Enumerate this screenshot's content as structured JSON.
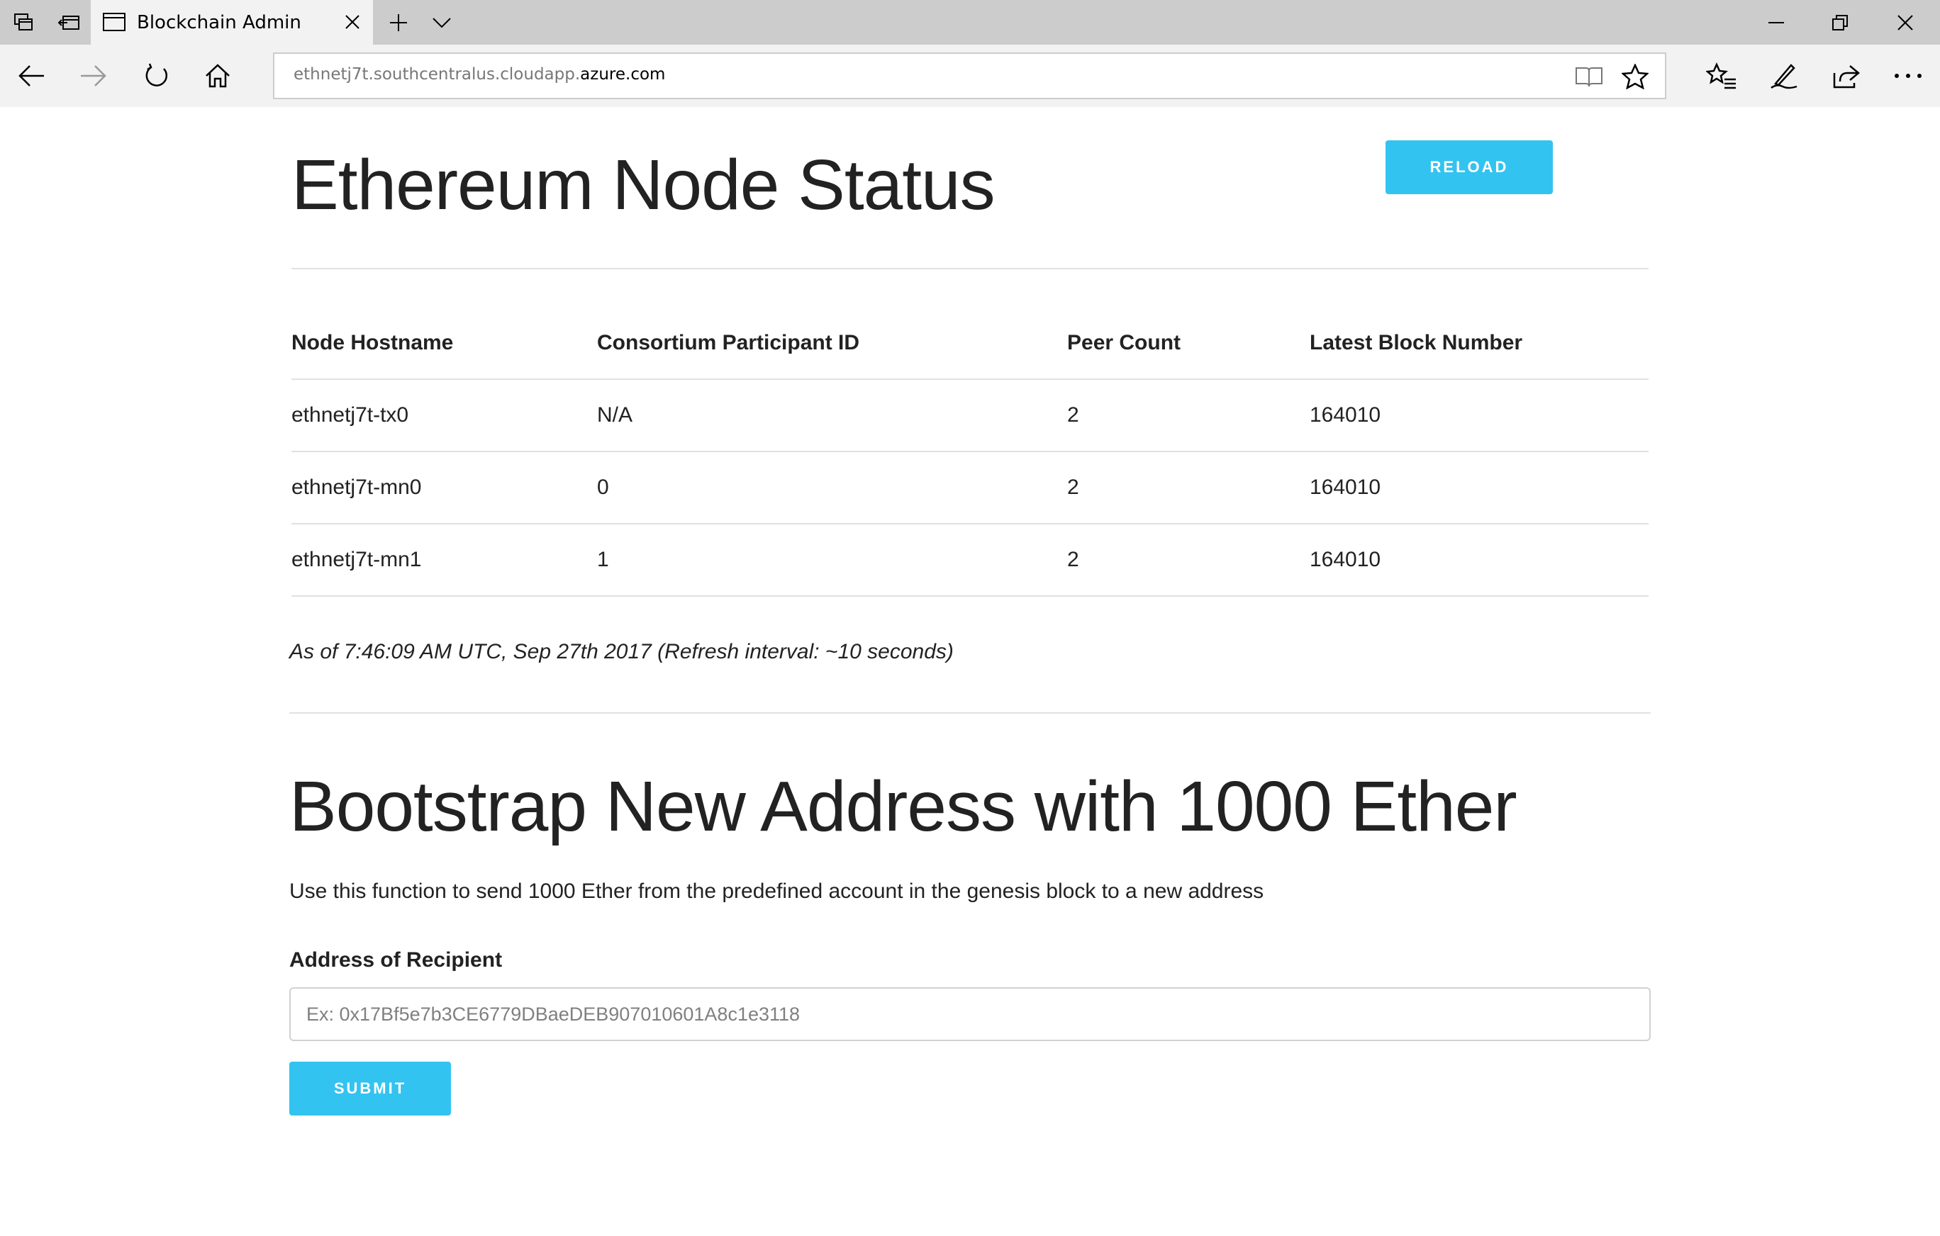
{
  "browser": {
    "tab_title": "Blockchain Admin",
    "url_host_prefix": "ethnetj7t.southcentralus.cloudapp.",
    "url_domain": "azure.com",
    "icons": {
      "tab_manager": "tab-manager-icon",
      "tabs_aside": "tabs-aside-icon",
      "page": "page-icon",
      "close_tab": "close-icon",
      "new_tab": "plus-icon",
      "tab_preview": "chevron-down-icon",
      "minimize": "minimize-icon",
      "restore": "restore-icon",
      "close_window": "close-icon",
      "back": "back-arrow-icon",
      "forward": "forward-arrow-icon",
      "refresh": "refresh-icon",
      "home": "home-icon",
      "reading_view": "book-icon",
      "favorite": "star-icon",
      "favorites_hub": "favorites-list-icon",
      "web_note": "pen-icon",
      "share": "share-icon",
      "more": "more-icon"
    }
  },
  "page": {
    "title": "Ethereum Node Status",
    "reload_label": "RELOAD",
    "table": {
      "headers": [
        "Node Hostname",
        "Consortium Participant ID",
        "Peer Count",
        "Latest Block Number"
      ],
      "rows": [
        [
          "ethnetj7t-tx0",
          "N/A",
          "2",
          "164010"
        ],
        [
          "ethnetj7t-mn0",
          "0",
          "2",
          "164010"
        ],
        [
          "ethnetj7t-mn1",
          "1",
          "2",
          "164010"
        ]
      ]
    },
    "timestamp": "As of 7:46:09 AM UTC, Sep 27th 2017 (Refresh interval: ~10 seconds)",
    "bootstrap": {
      "title": "Bootstrap New Address with 1000 Ether",
      "description": "Use this function to send 1000 Ether from the predefined account in the genesis block to a new address",
      "field_label": "Address of Recipient",
      "input_placeholder": "Ex: 0x17Bf5e7b3CE6779DBaeDEB907010601A8c1e3118",
      "input_value": "",
      "submit_label": "SUBMIT"
    }
  },
  "colors": {
    "accent": "#33c3f0",
    "chrome_tabbar": "#cccccc",
    "chrome_toolbar": "#f2f2f2",
    "divider": "#e1e1e1",
    "text": "#222222"
  }
}
